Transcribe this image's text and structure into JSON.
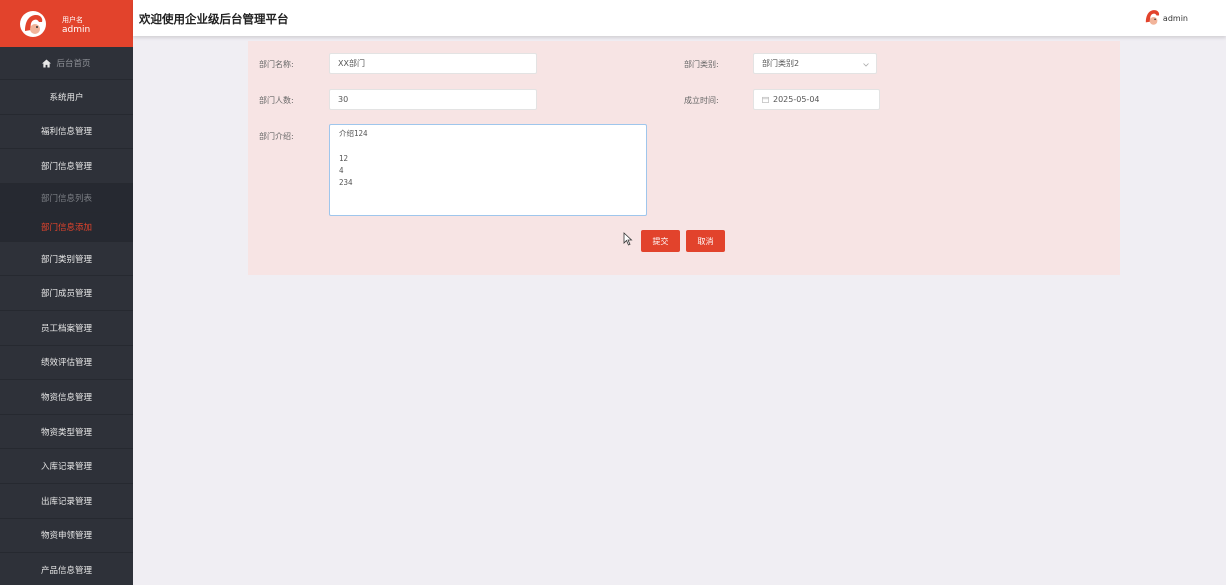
{
  "brand": {
    "user_label": "用户名",
    "user_name": "admin"
  },
  "header": {
    "title": "欢迎使用企业级后台管理平台",
    "user": "admin"
  },
  "sidebar": {
    "home": "后台首页",
    "items": [
      {
        "label": "系统用户"
      },
      {
        "label": "福利信息管理"
      },
      {
        "label": "部门信息管理"
      },
      {
        "label": "部门信息列表"
      },
      {
        "label": "部门信息添加"
      },
      {
        "label": "部门类别管理"
      },
      {
        "label": "部门成员管理"
      },
      {
        "label": "员工档案管理"
      },
      {
        "label": "绩效评估管理"
      },
      {
        "label": "物资信息管理"
      },
      {
        "label": "物资类型管理"
      },
      {
        "label": "入库记录管理"
      },
      {
        "label": "出库记录管理"
      },
      {
        "label": "物资申领管理"
      },
      {
        "label": "产品信息管理"
      }
    ]
  },
  "form": {
    "name_label": "部门名称:",
    "name_value": "XX部门",
    "category_label": "部门类别:",
    "category_value": "部门类别2",
    "count_label": "部门人数:",
    "count_value": "30",
    "date_label": "成立时间:",
    "date_value": "2025-05-04",
    "intro_label": "部门介绍:",
    "intro_value": "介绍124\n\n12\n4\n234",
    "submit": "提交",
    "cancel": "取消"
  },
  "colors": {
    "accent": "#e2432c",
    "sidebar": "#2e3139",
    "panel": "#f7e4e4"
  }
}
